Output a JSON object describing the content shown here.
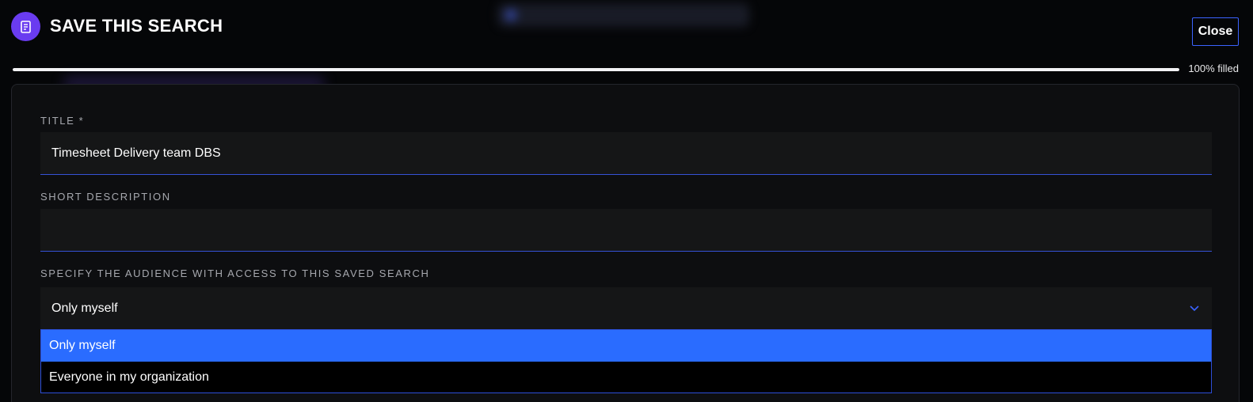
{
  "header": {
    "title": "SAVE THIS SEARCH",
    "icon": "saved-search-icon",
    "close_label": "Close"
  },
  "progress": {
    "label": "100% filled",
    "percent": 100
  },
  "form": {
    "title_field": {
      "label": "TITLE *",
      "value": "Timesheet Delivery team DBS"
    },
    "description_field": {
      "label": "SHORT DESCRIPTION",
      "value": ""
    },
    "audience_field": {
      "label": "SPECIFY THE AUDIENCE WITH ACCESS TO THIS SAVED SEARCH",
      "selected": "Only myself",
      "options": [
        {
          "label": "Only myself",
          "selected": true
        },
        {
          "label": "Everyone in my organization",
          "selected": false
        }
      ]
    }
  },
  "colors": {
    "accent": "#2a6cff",
    "icon_bg": "#6a3cf0",
    "focus_border": "#3552d6",
    "background": "#050608"
  }
}
